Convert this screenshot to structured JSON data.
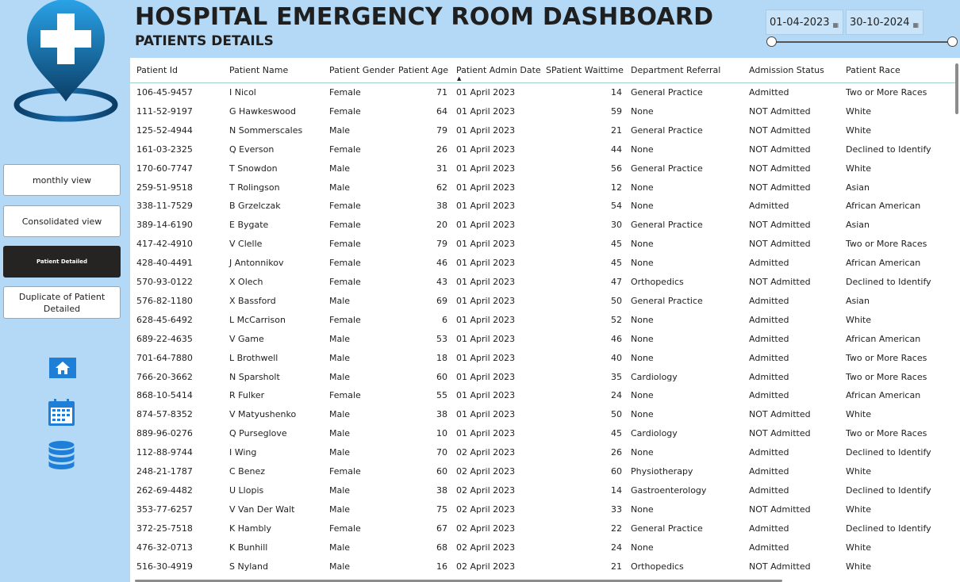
{
  "header": {
    "title": "HOSPITAL EMERGENCY ROOM DASHBOARD",
    "subtitle": "PATIENTS DETAILS"
  },
  "date_filter": {
    "start": "01-04-2023",
    "end": "30-10-2024"
  },
  "sidebar": {
    "buttons": [
      {
        "label": "monthly view"
      },
      {
        "label": "Consolidated view"
      },
      {
        "label": "Patient Detailed"
      },
      {
        "label": "Duplicate of Patient Detailed"
      }
    ],
    "icons": [
      "home-icon",
      "calendar-icon",
      "database-icon"
    ]
  },
  "colors": {
    "background": "#b3d9f7",
    "active_button": "#252423",
    "icon_blue": "#1f7fd6",
    "logo_dark": "#0a3d66"
  },
  "table": {
    "columns": [
      "Patient Id",
      "Patient Name",
      "Patient Gender",
      "Patient Age",
      "Patient Admin Date",
      "SPatient Waittime",
      "Department Referral",
      "Admission Status",
      "Patient Race"
    ],
    "rows": [
      [
        "106-45-9457",
        "I Nicol",
        "Female",
        "71",
        "01 April 2023",
        "14",
        "General Practice",
        "Admitted",
        "Two or More Races"
      ],
      [
        "111-52-9197",
        "G Hawkeswood",
        "Female",
        "64",
        "01 April 2023",
        "59",
        "None",
        "NOT Admitted",
        "White"
      ],
      [
        "125-52-4944",
        "N Sommerscales",
        "Male",
        "79",
        "01 April 2023",
        "21",
        "General Practice",
        "NOT Admitted",
        "White"
      ],
      [
        "161-03-2325",
        "Q Everson",
        "Female",
        "26",
        "01 April 2023",
        "44",
        "None",
        "NOT Admitted",
        "Declined to Identify"
      ],
      [
        "170-60-7747",
        "T Snowdon",
        "Male",
        "31",
        "01 April 2023",
        "56",
        "General Practice",
        "NOT Admitted",
        "White"
      ],
      [
        "259-51-9518",
        "T Rolingson",
        "Male",
        "62",
        "01 April 2023",
        "12",
        "None",
        "NOT Admitted",
        "Asian"
      ],
      [
        "338-11-7529",
        "B Grzelczak",
        "Female",
        "38",
        "01 April 2023",
        "54",
        "None",
        "Admitted",
        "African American"
      ],
      [
        "389-14-6190",
        "E Bygate",
        "Female",
        "20",
        "01 April 2023",
        "30",
        "General Practice",
        "NOT Admitted",
        "Asian"
      ],
      [
        "417-42-4910",
        "V Clelle",
        "Female",
        "79",
        "01 April 2023",
        "45",
        "None",
        "NOT Admitted",
        "Two or More Races"
      ],
      [
        "428-40-4491",
        "J Antonnikov",
        "Female",
        "46",
        "01 April 2023",
        "45",
        "None",
        "Admitted",
        "African American"
      ],
      [
        "570-93-0122",
        "X Olech",
        "Female",
        "43",
        "01 April 2023",
        "47",
        "Orthopedics",
        "NOT Admitted",
        "Declined to Identify"
      ],
      [
        "576-82-1180",
        "X Bassford",
        "Male",
        "69",
        "01 April 2023",
        "50",
        "General Practice",
        "Admitted",
        "Asian"
      ],
      [
        "628-45-6492",
        "L McCarrison",
        "Female",
        "6",
        "01 April 2023",
        "52",
        "None",
        "Admitted",
        "White"
      ],
      [
        "689-22-4635",
        "V Game",
        "Male",
        "53",
        "01 April 2023",
        "46",
        "None",
        "Admitted",
        "African American"
      ],
      [
        "701-64-7880",
        "L Brothwell",
        "Male",
        "18",
        "01 April 2023",
        "40",
        "None",
        "Admitted",
        "Two or More Races"
      ],
      [
        "766-20-3662",
        "N Sparsholt",
        "Male",
        "60",
        "01 April 2023",
        "35",
        "Cardiology",
        "Admitted",
        "Two or More Races"
      ],
      [
        "868-10-5414",
        "R Fulker",
        "Female",
        "55",
        "01 April 2023",
        "24",
        "None",
        "Admitted",
        "African American"
      ],
      [
        "874-57-8352",
        "V Matyushenko",
        "Male",
        "38",
        "01 April 2023",
        "50",
        "None",
        "NOT Admitted",
        "White"
      ],
      [
        "889-96-0276",
        "Q Purseglove",
        "Male",
        "10",
        "01 April 2023",
        "45",
        "Cardiology",
        "NOT Admitted",
        "Two or More Races"
      ],
      [
        "112-88-9744",
        "I Wing",
        "Male",
        "70",
        "02 April 2023",
        "26",
        "None",
        "Admitted",
        "Declined to Identify"
      ],
      [
        "248-21-1787",
        "C Benez",
        "Female",
        "60",
        "02 April 2023",
        "60",
        "Physiotherapy",
        "Admitted",
        "White"
      ],
      [
        "262-69-4482",
        "U Llopis",
        "Male",
        "38",
        "02 April 2023",
        "14",
        "Gastroenterology",
        "Admitted",
        "Declined to Identify"
      ],
      [
        "353-77-6257",
        "V Van Der Walt",
        "Male",
        "75",
        "02 April 2023",
        "33",
        "None",
        "NOT Admitted",
        "White"
      ],
      [
        "372-25-7518",
        "K Hambly",
        "Female",
        "67",
        "02 April 2023",
        "22",
        "General Practice",
        "Admitted",
        "Declined to Identify"
      ],
      [
        "476-32-0713",
        "K Bunhill",
        "Male",
        "68",
        "02 April 2023",
        "24",
        "None",
        "Admitted",
        "White"
      ],
      [
        "516-30-4919",
        "S Nyland",
        "Male",
        "16",
        "02 April 2023",
        "21",
        "Orthopedics",
        "NOT Admitted",
        "White"
      ]
    ]
  }
}
